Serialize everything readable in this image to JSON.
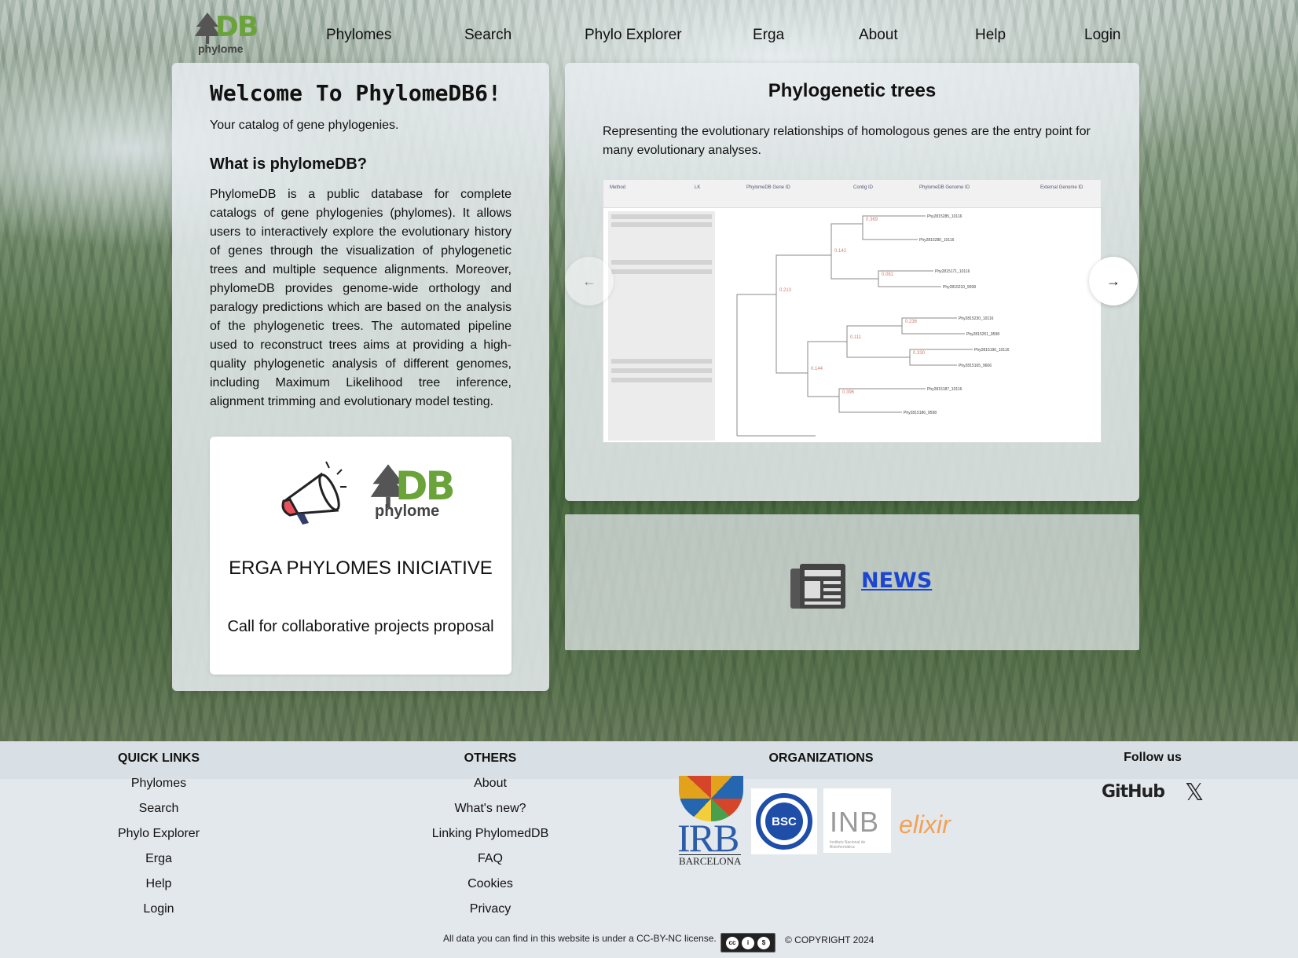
{
  "header": {
    "logo_text": "DB",
    "logo_sub": "phylome",
    "nav": [
      "Phylomes",
      "Search",
      "Phylo Explorer",
      "Erga",
      "About",
      "Help",
      "Login"
    ]
  },
  "welcome": {
    "title": "Welcome To PhylomeDB6!",
    "subtitle": "Your catalog of gene phylogenies.",
    "heading": "What is phylomeDB?",
    "paragraph": "PhylomeDB is a public database for complete catalogs of gene phylogenies (phylomes). It allows users to interactively explore the evolutionary history of genes through the visualization of phylogenetic trees and multiple sequence alignments. Moreover, phylomeDB provides genome-wide orthology and paralogy predictions which are based on the analysis of the phylogenetic trees. The automated pipeline used to reconstruct trees aims at providing a high-quality phylogenetic analysis of different genomes, including Maximum Likelihood tree inference, alignment trimming and evolutionary model testing."
  },
  "erga": {
    "logo_text": "DB",
    "logo_sub": "phylome",
    "title": "ERGA PHYLOMES INICIATIVE",
    "description": "Call for collaborative projects proposal"
  },
  "carousel": {
    "title": "Phylogenetic trees",
    "description": "Representing the evolutionary relationships of homologous genes are the entry point for many evolutionary analyses.",
    "prev_icon": "arrow-left-icon",
    "next_icon": "arrow-right-icon"
  },
  "news": {
    "label": "NEWS",
    "icon": "newspaper-icon"
  },
  "footer": {
    "quick_links": {
      "title": "QUICK LINKS",
      "items": [
        "Phylomes",
        "Search",
        "Phylo Explorer",
        "Erga",
        "Help",
        "Login"
      ]
    },
    "others": {
      "title": "OTHERS",
      "items": [
        "About",
        "What's new?",
        "Linking PhylomedDB",
        "FAQ",
        "Cookies",
        "Privacy"
      ]
    },
    "organizations": {
      "title": "ORGANIZATIONS",
      "irb_text": "IRB",
      "irb_sub": "BARCELONA",
      "bsc_text": "BSC",
      "inb_text": "INB",
      "inb_sub": "Instituto Nacional de Bioinformática",
      "elixir_text": "elixir"
    },
    "follow": {
      "title": "Follow us",
      "github": "GitHub",
      "x": "𝕏"
    },
    "license": "All data you can find in this website is under a CC-BY-NC license.",
    "copyright": "© COPYRIGHT 2024"
  },
  "colors": {
    "brand_green": "#6aa339",
    "news_link": "#1c46d1"
  }
}
